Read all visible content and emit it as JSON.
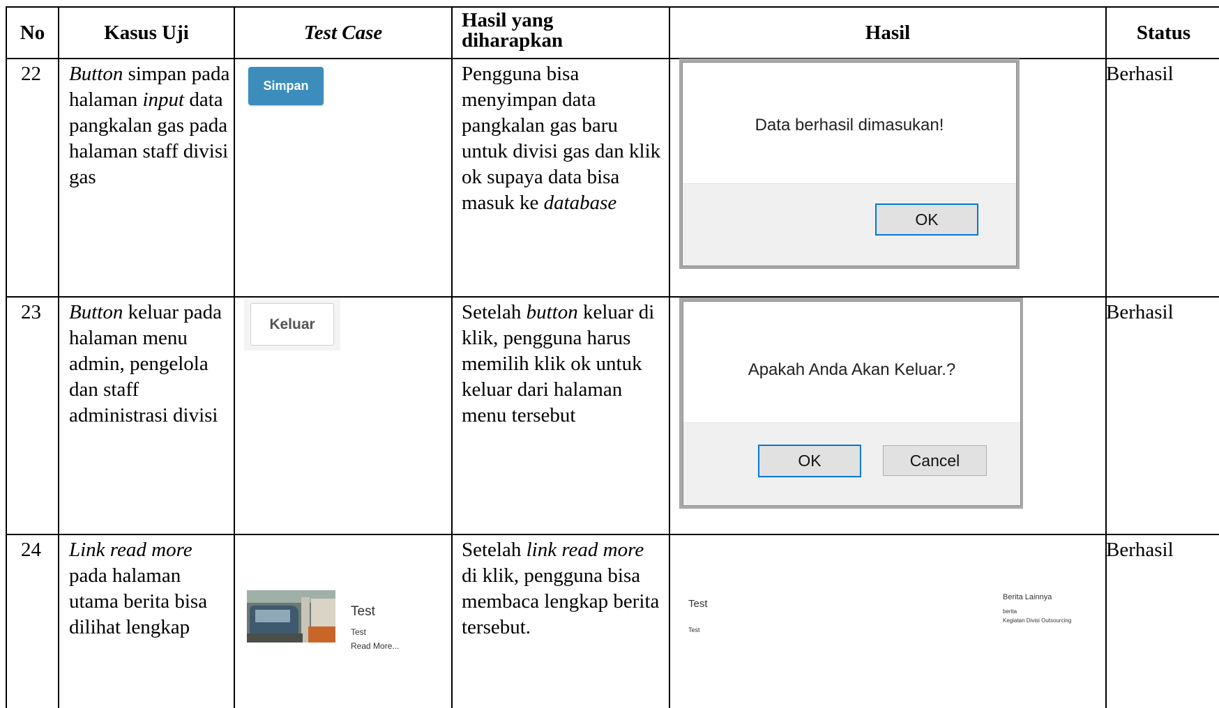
{
  "headers": {
    "no": "No",
    "kasus": "Kasus Uji",
    "test_case": "Test Case",
    "harapan_line1": "Hasil yang",
    "harapan_line2": "diharapkan",
    "hasil": "Hasil",
    "status": "Status"
  },
  "rows": [
    {
      "no": "22",
      "kasus": [
        [
          "Button",
          true
        ],
        [
          " simpan pada halaman ",
          false
        ],
        [
          "input",
          true
        ],
        [
          " data pangkalan gas pada halaman staff divisi gas",
          false
        ]
      ],
      "test_case_button": "Simpan",
      "harapan": [
        [
          "Pengguna bisa menyimpan data pangkalan gas baru untuk divisi gas dan klik ok supaya data bisa masuk ke ",
          false
        ],
        [
          "database",
          true
        ]
      ],
      "dialog_message": "Data berhasil dimasukan!",
      "dialog_ok": "OK",
      "status": "Berhasil"
    },
    {
      "no": "23",
      "kasus": [
        [
          "Button",
          true
        ],
        [
          " keluar pada halaman menu admin, pengelola dan staff administrasi divisi",
          false
        ]
      ],
      "test_case_button": "Keluar",
      "harapan": [
        [
          "Setelah ",
          false
        ],
        [
          "button",
          true
        ],
        [
          " keluar di klik, pengguna harus memilih klik ok untuk keluar dari halaman menu tersebut",
          false
        ]
      ],
      "dialog_message": "Apakah Anda Akan Keluar.?",
      "dialog_ok": "OK",
      "dialog_cancel": "Cancel",
      "status": "Berhasil"
    },
    {
      "no": "24",
      "kasus": [
        [
          "Link read more",
          true
        ],
        [
          " pada halaman utama berita bisa dilihat lengkap",
          false
        ]
      ],
      "news_title": "Test",
      "news_body": "Test",
      "news_read_more": "Read More...",
      "harapan": [
        [
          "Setelah ",
          false
        ],
        [
          "link read more",
          true
        ],
        [
          " di klik, pengguna bisa membaca lengkap berita tersebut.",
          false
        ]
      ],
      "result_title": "Test",
      "result_body": "Test",
      "sidebar_title": "Berita Lainnya",
      "sidebar_item1": "berita",
      "sidebar_item2": "Kegiatan Divisi Outsourcing",
      "status": "Berhasil"
    }
  ]
}
